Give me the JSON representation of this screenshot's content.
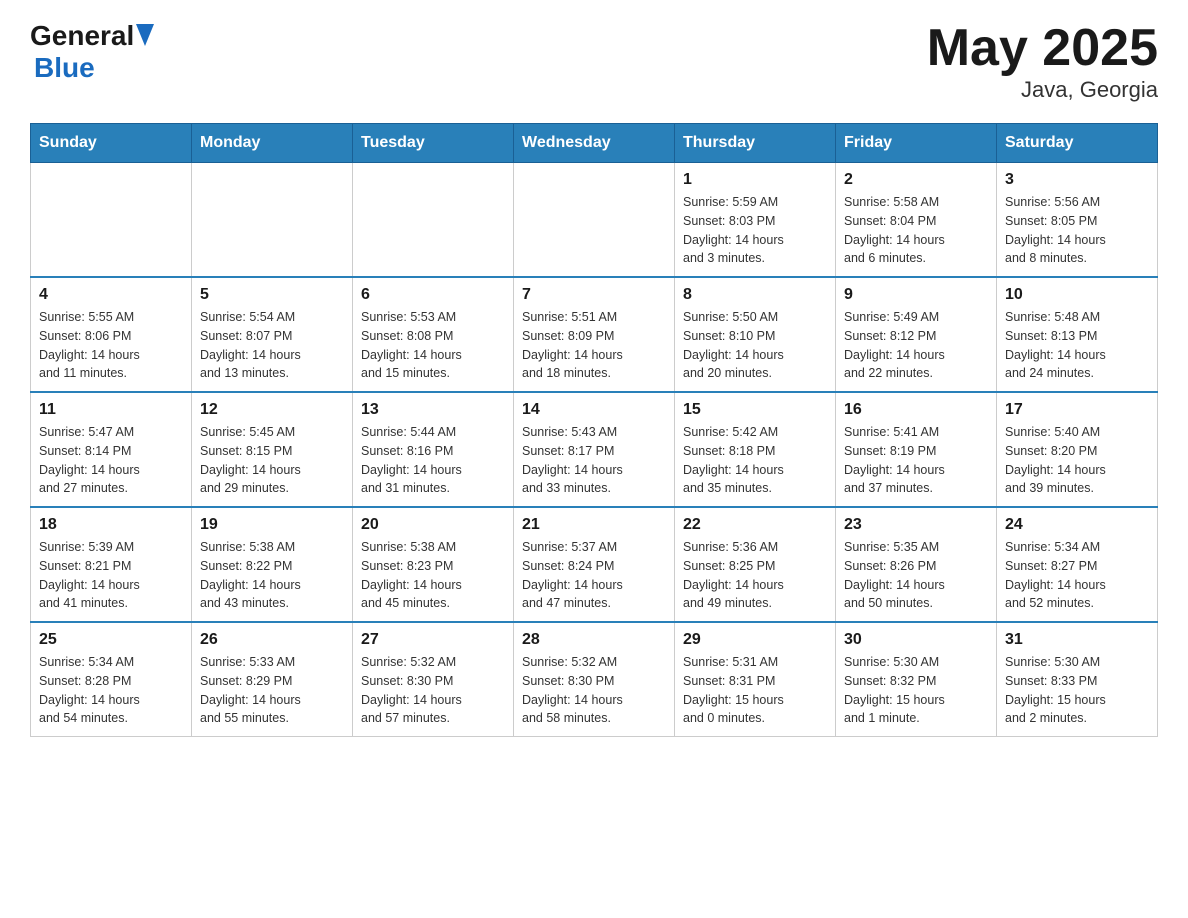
{
  "header": {
    "logo_general": "General",
    "logo_blue": "Blue",
    "month_year": "May 2025",
    "location": "Java, Georgia"
  },
  "days_of_week": [
    "Sunday",
    "Monday",
    "Tuesday",
    "Wednesday",
    "Thursday",
    "Friday",
    "Saturday"
  ],
  "weeks": [
    [
      {
        "day": "",
        "info": ""
      },
      {
        "day": "",
        "info": ""
      },
      {
        "day": "",
        "info": ""
      },
      {
        "day": "",
        "info": ""
      },
      {
        "day": "1",
        "info": "Sunrise: 5:59 AM\nSunset: 8:03 PM\nDaylight: 14 hours\nand 3 minutes."
      },
      {
        "day": "2",
        "info": "Sunrise: 5:58 AM\nSunset: 8:04 PM\nDaylight: 14 hours\nand 6 minutes."
      },
      {
        "day": "3",
        "info": "Sunrise: 5:56 AM\nSunset: 8:05 PM\nDaylight: 14 hours\nand 8 minutes."
      }
    ],
    [
      {
        "day": "4",
        "info": "Sunrise: 5:55 AM\nSunset: 8:06 PM\nDaylight: 14 hours\nand 11 minutes."
      },
      {
        "day": "5",
        "info": "Sunrise: 5:54 AM\nSunset: 8:07 PM\nDaylight: 14 hours\nand 13 minutes."
      },
      {
        "day": "6",
        "info": "Sunrise: 5:53 AM\nSunset: 8:08 PM\nDaylight: 14 hours\nand 15 minutes."
      },
      {
        "day": "7",
        "info": "Sunrise: 5:51 AM\nSunset: 8:09 PM\nDaylight: 14 hours\nand 18 minutes."
      },
      {
        "day": "8",
        "info": "Sunrise: 5:50 AM\nSunset: 8:10 PM\nDaylight: 14 hours\nand 20 minutes."
      },
      {
        "day": "9",
        "info": "Sunrise: 5:49 AM\nSunset: 8:12 PM\nDaylight: 14 hours\nand 22 minutes."
      },
      {
        "day": "10",
        "info": "Sunrise: 5:48 AM\nSunset: 8:13 PM\nDaylight: 14 hours\nand 24 minutes."
      }
    ],
    [
      {
        "day": "11",
        "info": "Sunrise: 5:47 AM\nSunset: 8:14 PM\nDaylight: 14 hours\nand 27 minutes."
      },
      {
        "day": "12",
        "info": "Sunrise: 5:45 AM\nSunset: 8:15 PM\nDaylight: 14 hours\nand 29 minutes."
      },
      {
        "day": "13",
        "info": "Sunrise: 5:44 AM\nSunset: 8:16 PM\nDaylight: 14 hours\nand 31 minutes."
      },
      {
        "day": "14",
        "info": "Sunrise: 5:43 AM\nSunset: 8:17 PM\nDaylight: 14 hours\nand 33 minutes."
      },
      {
        "day": "15",
        "info": "Sunrise: 5:42 AM\nSunset: 8:18 PM\nDaylight: 14 hours\nand 35 minutes."
      },
      {
        "day": "16",
        "info": "Sunrise: 5:41 AM\nSunset: 8:19 PM\nDaylight: 14 hours\nand 37 minutes."
      },
      {
        "day": "17",
        "info": "Sunrise: 5:40 AM\nSunset: 8:20 PM\nDaylight: 14 hours\nand 39 minutes."
      }
    ],
    [
      {
        "day": "18",
        "info": "Sunrise: 5:39 AM\nSunset: 8:21 PM\nDaylight: 14 hours\nand 41 minutes."
      },
      {
        "day": "19",
        "info": "Sunrise: 5:38 AM\nSunset: 8:22 PM\nDaylight: 14 hours\nand 43 minutes."
      },
      {
        "day": "20",
        "info": "Sunrise: 5:38 AM\nSunset: 8:23 PM\nDaylight: 14 hours\nand 45 minutes."
      },
      {
        "day": "21",
        "info": "Sunrise: 5:37 AM\nSunset: 8:24 PM\nDaylight: 14 hours\nand 47 minutes."
      },
      {
        "day": "22",
        "info": "Sunrise: 5:36 AM\nSunset: 8:25 PM\nDaylight: 14 hours\nand 49 minutes."
      },
      {
        "day": "23",
        "info": "Sunrise: 5:35 AM\nSunset: 8:26 PM\nDaylight: 14 hours\nand 50 minutes."
      },
      {
        "day": "24",
        "info": "Sunrise: 5:34 AM\nSunset: 8:27 PM\nDaylight: 14 hours\nand 52 minutes."
      }
    ],
    [
      {
        "day": "25",
        "info": "Sunrise: 5:34 AM\nSunset: 8:28 PM\nDaylight: 14 hours\nand 54 minutes."
      },
      {
        "day": "26",
        "info": "Sunrise: 5:33 AM\nSunset: 8:29 PM\nDaylight: 14 hours\nand 55 minutes."
      },
      {
        "day": "27",
        "info": "Sunrise: 5:32 AM\nSunset: 8:30 PM\nDaylight: 14 hours\nand 57 minutes."
      },
      {
        "day": "28",
        "info": "Sunrise: 5:32 AM\nSunset: 8:30 PM\nDaylight: 14 hours\nand 58 minutes."
      },
      {
        "day": "29",
        "info": "Sunrise: 5:31 AM\nSunset: 8:31 PM\nDaylight: 15 hours\nand 0 minutes."
      },
      {
        "day": "30",
        "info": "Sunrise: 5:30 AM\nSunset: 8:32 PM\nDaylight: 15 hours\nand 1 minute."
      },
      {
        "day": "31",
        "info": "Sunrise: 5:30 AM\nSunset: 8:33 PM\nDaylight: 15 hours\nand 2 minutes."
      }
    ]
  ]
}
